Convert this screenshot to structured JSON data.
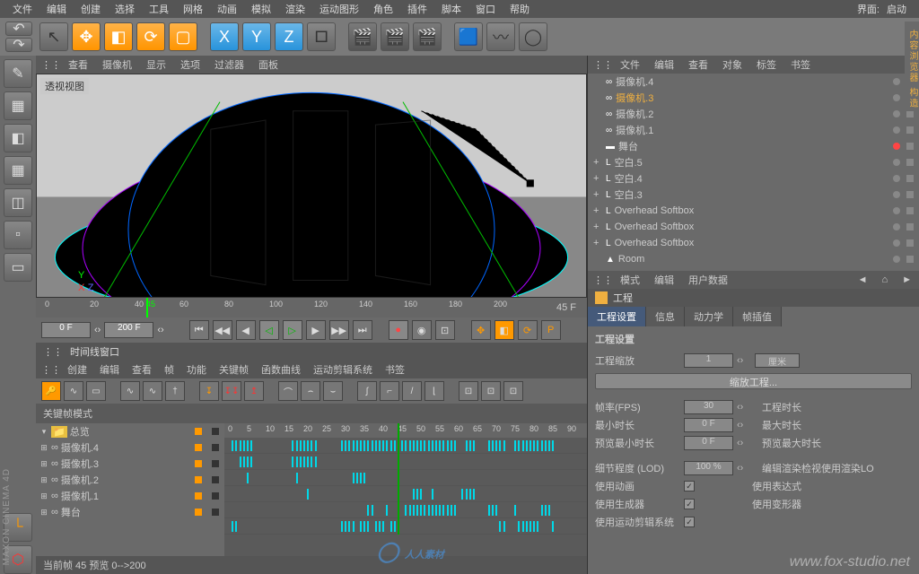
{
  "menubar": {
    "items": [
      "文件",
      "编辑",
      "创建",
      "选择",
      "工具",
      "网格",
      "动画",
      "模拟",
      "渲染",
      "运动图形",
      "角色",
      "插件",
      "脚本",
      "窗口",
      "帮助"
    ],
    "ui_label": "界面:",
    "ui_mode": "启动"
  },
  "viewport": {
    "menu": [
      "查看",
      "摄像机",
      "显示",
      "选项",
      "过滤器",
      "面板"
    ],
    "label": "透视视图",
    "ruler": {
      "ticks": [
        0,
        20,
        40,
        45,
        60,
        80,
        100,
        120,
        140,
        160,
        180,
        200
      ],
      "playhead": 45,
      "display": "45 F"
    }
  },
  "transport": {
    "start": "0 F",
    "end": "200 F"
  },
  "timeline": {
    "title": "时间线窗口",
    "menu": [
      "创建",
      "编辑",
      "查看",
      "帧",
      "功能",
      "关键帧",
      "函数曲线",
      "运动剪辑系统",
      "书签"
    ],
    "mode_label": "关键帧模式",
    "ruler_ticks": [
      0,
      5,
      10,
      15,
      20,
      25,
      30,
      35,
      40,
      45,
      50,
      55,
      60,
      65,
      70,
      75,
      80,
      85,
      90
    ],
    "playhead": 45,
    "rows": [
      {
        "label": "总览",
        "folder": true,
        "kf": [
          1,
          2,
          3,
          4,
          5,
          6,
          17,
          18,
          19,
          20,
          21,
          22,
          23,
          30,
          31,
          32,
          33,
          34,
          35,
          36,
          37,
          38,
          39,
          40,
          41,
          42,
          43,
          44,
          45,
          46,
          47,
          48,
          49,
          50,
          51,
          52,
          53,
          54,
          55,
          56,
          57,
          58,
          59,
          60,
          63,
          64,
          65,
          69,
          70,
          71,
          72,
          73,
          76,
          77,
          78,
          79,
          80,
          81,
          82,
          83,
          84,
          85,
          86
        ]
      },
      {
        "label": "摄像机.4",
        "kf": [
          3,
          4,
          5,
          6,
          17,
          18,
          19,
          20,
          21,
          22,
          23
        ]
      },
      {
        "label": "摄像机.3",
        "kf": [
          5,
          18,
          33,
          34,
          35,
          36
        ]
      },
      {
        "label": "摄像机.2",
        "kf": [
          21,
          49,
          50,
          51,
          54,
          62,
          63,
          64,
          65
        ]
      },
      {
        "label": "摄像机.1",
        "kf": [
          37,
          38,
          42,
          47,
          48,
          49,
          50,
          51,
          52,
          53,
          54,
          55,
          56,
          57,
          58,
          59,
          60,
          69,
          70,
          71,
          76,
          83,
          84,
          85
        ]
      },
      {
        "label": "舞台",
        "kf": [
          1,
          2,
          30,
          31,
          32,
          33,
          35,
          36,
          37,
          39,
          40,
          41,
          43,
          44,
          45,
          72,
          73,
          77,
          78,
          79,
          80,
          81,
          82,
          86
        ]
      }
    ],
    "status": "当前帧  45  预览  0-->200"
  },
  "object_manager": {
    "menu": [
      "文件",
      "编辑",
      "查看",
      "对象",
      "标签",
      "书签"
    ],
    "objects": [
      {
        "icon": "∞",
        "label": "摄像机.4"
      },
      {
        "icon": "∞",
        "label": "摄像机.3",
        "sel": true
      },
      {
        "icon": "∞",
        "label": "摄像机.2"
      },
      {
        "icon": "∞",
        "label": "摄像机.1"
      },
      {
        "icon": "▬",
        "label": "舞台",
        "red": true
      },
      {
        "icon": "L",
        "label": "空白.5",
        "exp": "+"
      },
      {
        "icon": "L",
        "label": "空白.4",
        "exp": "+"
      },
      {
        "icon": "L",
        "label": "空白.3",
        "exp": "+"
      },
      {
        "icon": "L",
        "label": "Overhead Softbox",
        "exp": "+"
      },
      {
        "icon": "L",
        "label": "Overhead Softbox",
        "exp": "+"
      },
      {
        "icon": "L",
        "label": "Overhead Softbox",
        "exp": "+"
      },
      {
        "icon": "▲",
        "label": "Room"
      }
    ]
  },
  "attributes": {
    "menu": [
      "模式",
      "编辑",
      "用户数据"
    ],
    "title": "工程",
    "tabs": [
      "工程设置",
      "信息",
      "动力学",
      "帧插值"
    ],
    "section": "工程设置",
    "scale_label": "工程缩放",
    "scale_val": "1",
    "scale_unit": "厘米",
    "scale_btn": "缩放工程...",
    "fields": {
      "fps_label": "帧率(FPS)",
      "fps_val": "30",
      "duration_label": "工程时长",
      "mintime_label": "最小时长",
      "mintime_val": "0 F",
      "maxtime_label": "最大时长",
      "prevmin_label": "预览最小时长",
      "prevmin_val": "0 F",
      "prevmax_label": "预览最大时长",
      "lod_label": "细节程度 (LOD)",
      "lod_val": "100 %",
      "editrender_label": "编辑渲染检视使用渲染LO",
      "anim_label": "使用动画",
      "expr_label": "使用表达式",
      "gen_label": "使用生成器",
      "deform_label": "使用变形器",
      "motion_label": "使用运动剪辑系统"
    }
  },
  "watermarks": {
    "wm1": "人人素材",
    "wm2": "www.fox-studio.net",
    "brand": "MAXON CINEMA 4D"
  }
}
